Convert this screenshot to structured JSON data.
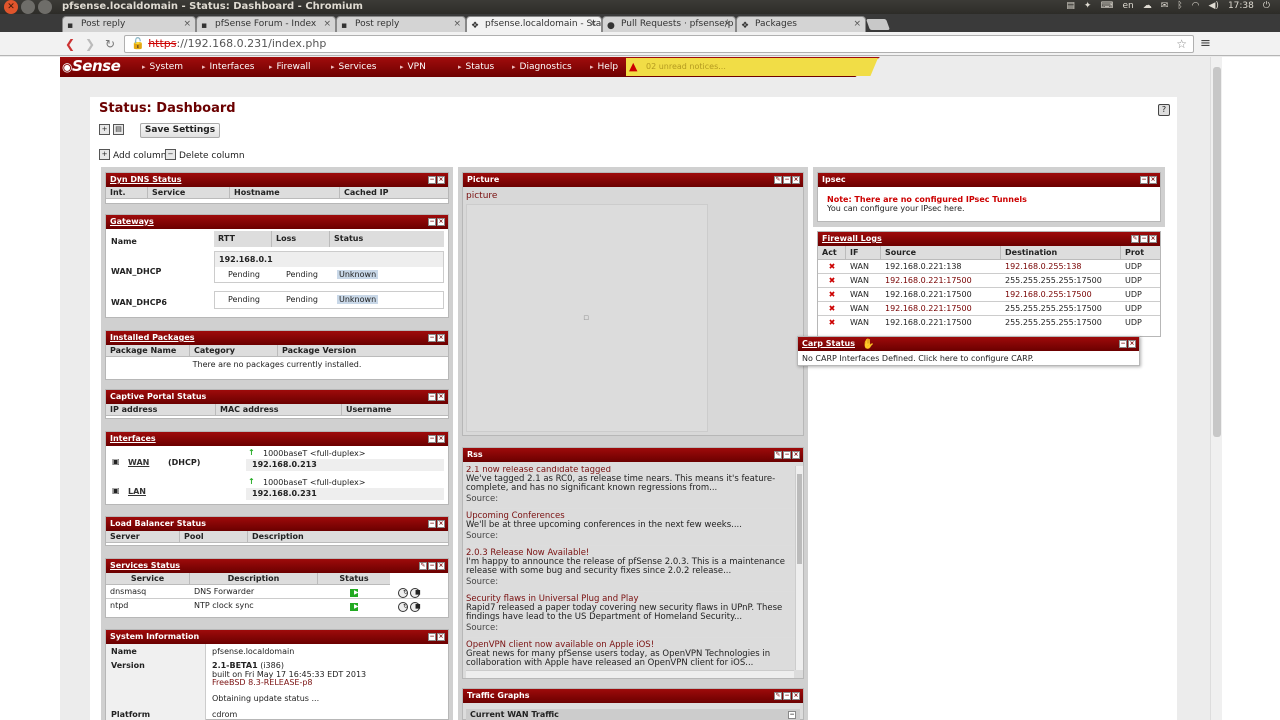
{
  "window": {
    "title": "pfsense.localdomain - Status: Dashboard - Chromium",
    "tray": {
      "lang": "en",
      "clock": "17:38"
    }
  },
  "tabs": [
    {
      "label": "Post reply",
      "active": false
    },
    {
      "label": "pfSense Forum - Index",
      "active": false
    },
    {
      "label": "Post reply",
      "active": false
    },
    {
      "label": "pfsense.localdomain - Sta",
      "active": true
    },
    {
      "label": "Pull Requests · pfsense/p",
      "active": false
    },
    {
      "label": "Packages",
      "active": false
    }
  ],
  "address": {
    "scheme": "https",
    "rest": "://192.168.0.231/index.php"
  },
  "pfsense": {
    "logo": "Sense",
    "menu": [
      "System",
      "Interfaces",
      "Firewall",
      "Services",
      "VPN",
      "Status",
      "Diagnostics",
      "Help"
    ],
    "notice": "02 unread notices..."
  },
  "page": {
    "title": "Status: Dashboard",
    "save_button": "Save Settings",
    "add_column": "Add column",
    "delete_column": "Delete column"
  },
  "dyndns": {
    "title": "Dyn DNS Status",
    "headers": [
      "Int.",
      "Service",
      "Hostname",
      "Cached IP"
    ]
  },
  "gateways": {
    "title": "Gateways",
    "headers": [
      "Name",
      "RTT",
      "Loss",
      "Status"
    ],
    "rows": [
      {
        "name": "WAN_DHCP",
        "ip": "192.168.0.1",
        "rtt": "Pending",
        "loss": "Pending",
        "status": "Unknown"
      },
      {
        "name": "WAN_DHCP6",
        "ip": "",
        "rtt": "Pending",
        "loss": "Pending",
        "status": "Unknown"
      }
    ]
  },
  "packages": {
    "title": "Installed Packages",
    "headers": [
      "Package Name",
      "Category",
      "Package Version"
    ],
    "empty": "There are no packages currently installed."
  },
  "captive": {
    "title": "Captive Portal Status",
    "headers": [
      "IP address",
      "MAC address",
      "Username"
    ]
  },
  "interfaces": {
    "title": "Interfaces",
    "rows": [
      {
        "name": "WAN",
        "type": "(DHCP)",
        "media": "1000baseT <full-duplex>",
        "ip": "192.168.0.213"
      },
      {
        "name": "LAN",
        "type": "",
        "media": "1000baseT <full-duplex>",
        "ip": "192.168.0.231"
      }
    ]
  },
  "loadbalancer": {
    "title": "Load Balancer Status",
    "headers": [
      "Server",
      "Pool",
      "Description"
    ]
  },
  "services": {
    "title": "Services Status",
    "headers": [
      "Service",
      "Description",
      "Status"
    ],
    "rows": [
      {
        "service": "dnsmasq",
        "description": "DNS Forwarder"
      },
      {
        "service": "ntpd",
        "description": "NTP clock sync"
      }
    ]
  },
  "sysinfo": {
    "title": "System Information",
    "name_label": "Name",
    "name": "pfsense.localdomain",
    "version_label": "Version",
    "version": "2.1-BETA1",
    "arch": "(i386)",
    "built": "built on Fri May 17 16:45:33 EDT 2013",
    "freebsd": "FreeBSD 8.3-RELEASE-p8",
    "update": "Obtaining update status ...",
    "platform_label": "Platform",
    "platform": "cdrom"
  },
  "picture": {
    "title": "Picture",
    "label": "picture"
  },
  "rss": {
    "title": "Rss",
    "items": [
      {
        "title": "2.1 now release candidate tagged",
        "body": "We've tagged 2.1 as RC0, as release time nears. This means it's feature-complete, and has no significant known regressions from...",
        "source": "Source:"
      },
      {
        "title": "Upcoming Conferences",
        "body": "We'll be at three upcoming conferences in the next few weeks....",
        "source": "Source:"
      },
      {
        "title": "2.0.3 Release Now Available!",
        "body": "I'm happy to announce the release of pfSense 2.0.3. This is a maintenance release with some bug and security fixes since 2.0.2 release...",
        "source": "Source:"
      },
      {
        "title": "Security flaws in Universal Plug and Play",
        "body": "Rapid7 released a paper today covering new security flaws in UPnP. These findings have lead to the US Department of Homeland Security...",
        "source": "Source:"
      },
      {
        "title": "OpenVPN client now available on Apple iOS!",
        "body": "Great news for many pfSense users today, as OpenVPN Technologies in collaboration with Apple have released an OpenVPN client for iOS...",
        "source": ""
      }
    ]
  },
  "traffic": {
    "title": "Traffic Graphs",
    "sub": "Current WAN Traffic"
  },
  "ipsec": {
    "title": "Ipsec",
    "note": "Note: There are no configured IPsec Tunnels",
    "hint": "You can configure your IPsec here."
  },
  "firewall": {
    "title": "Firewall Logs",
    "headers": [
      "Act",
      "IF",
      "Source",
      "Destination",
      "Prot"
    ],
    "rows": [
      {
        "if": "WAN",
        "src": "192.168.0.221:138",
        "dst": "192.168.0.255:138",
        "prot": "UDP"
      },
      {
        "if": "WAN",
        "src": "192.168.0.221:17500",
        "dst": "255.255.255.255:17500",
        "prot": "UDP"
      },
      {
        "if": "WAN",
        "src": "192.168.0.221:17500",
        "dst": "192.168.0.255:17500",
        "prot": "UDP"
      },
      {
        "if": "WAN",
        "src": "192.168.0.221:17500",
        "dst": "255.255.255.255:17500",
        "prot": "UDP"
      },
      {
        "if": "WAN",
        "src": "192.168.0.221:17500",
        "dst": "255.255.255.255:17500",
        "prot": "UDP"
      }
    ]
  },
  "carp": {
    "title": "Carp Status",
    "message": "No CARP Interfaces Defined. Click here to configure CARP."
  }
}
